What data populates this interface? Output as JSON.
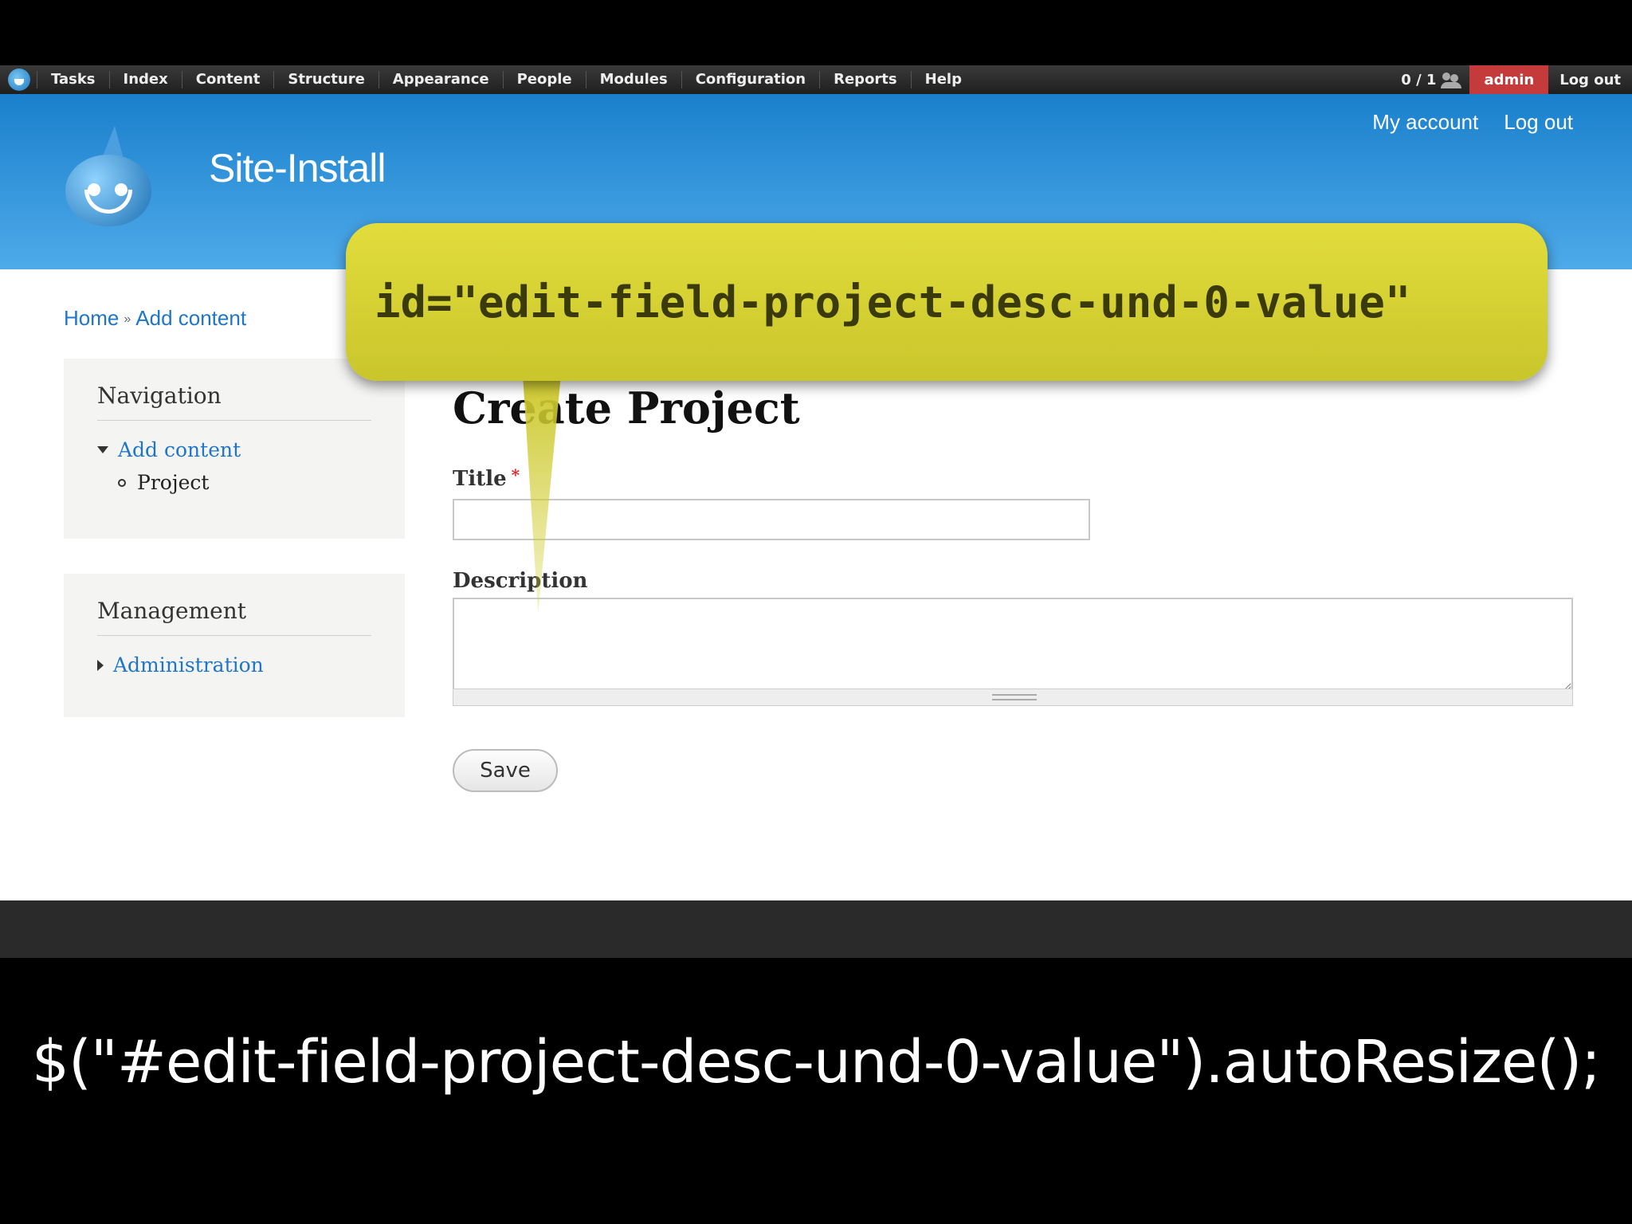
{
  "toolbar": {
    "items": [
      "Tasks",
      "Index",
      "Content",
      "Structure",
      "Appearance",
      "People",
      "Modules",
      "Configuration",
      "Reports",
      "Help"
    ],
    "shortcuts": "0 / 1",
    "user": "admin",
    "logout": "Log out"
  },
  "header": {
    "site_name": "Site-Install",
    "my_account": "My account",
    "log_out": "Log out"
  },
  "breadcrumb": {
    "home": "Home",
    "sep": "»",
    "current": "Add content"
  },
  "sidebar": {
    "navigation": {
      "title": "Navigation",
      "item": "Add content",
      "subitem": "Project"
    },
    "management": {
      "title": "Management",
      "item": "Administration"
    }
  },
  "form": {
    "page_title": "Create Project",
    "title_label": "Title",
    "required_mark": "*",
    "title_value": "",
    "description_label": "Description",
    "description_value": "",
    "save_label": "Save"
  },
  "callout": {
    "text": "id=\"edit-field-project-desc-und-0-value\""
  },
  "code": {
    "line": "$(\"#edit-field-project-desc-und-0-value\").autoResize();"
  }
}
